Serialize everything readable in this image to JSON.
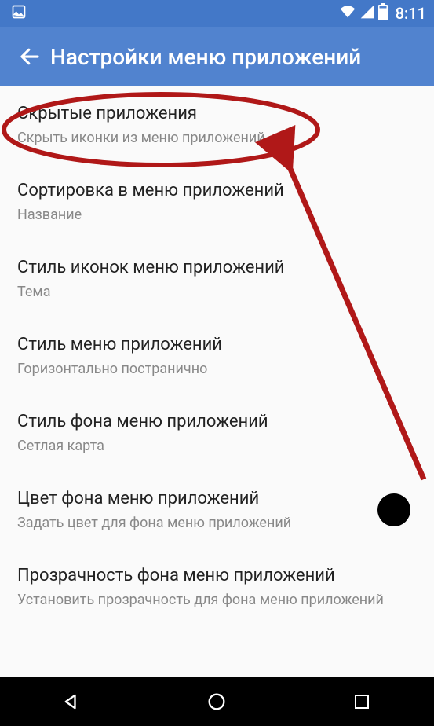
{
  "status": {
    "time": "8:11"
  },
  "appbar": {
    "title": "Настройки меню приложений"
  },
  "settings": [
    {
      "title": "Скрытые приложения",
      "subtitle": "Скрыть иконки из меню приложений"
    },
    {
      "title": "Сортировка в меню приложений",
      "subtitle": "Название"
    },
    {
      "title": "Стиль иконок меню приложений",
      "subtitle": "Тема"
    },
    {
      "title": "Стиль меню приложений",
      "subtitle": "Горизонтально постранично"
    },
    {
      "title": "Стиль фона меню приложений",
      "subtitle": "Сетлая карта"
    },
    {
      "title": "Цвет фона меню приложений",
      "subtitle": "Задать цвет для фона меню приложений",
      "swatch": "#000000"
    },
    {
      "title": "Прозрачность фона меню приложений",
      "subtitle": "Установить прозрачность для фона меню приложений"
    }
  ]
}
